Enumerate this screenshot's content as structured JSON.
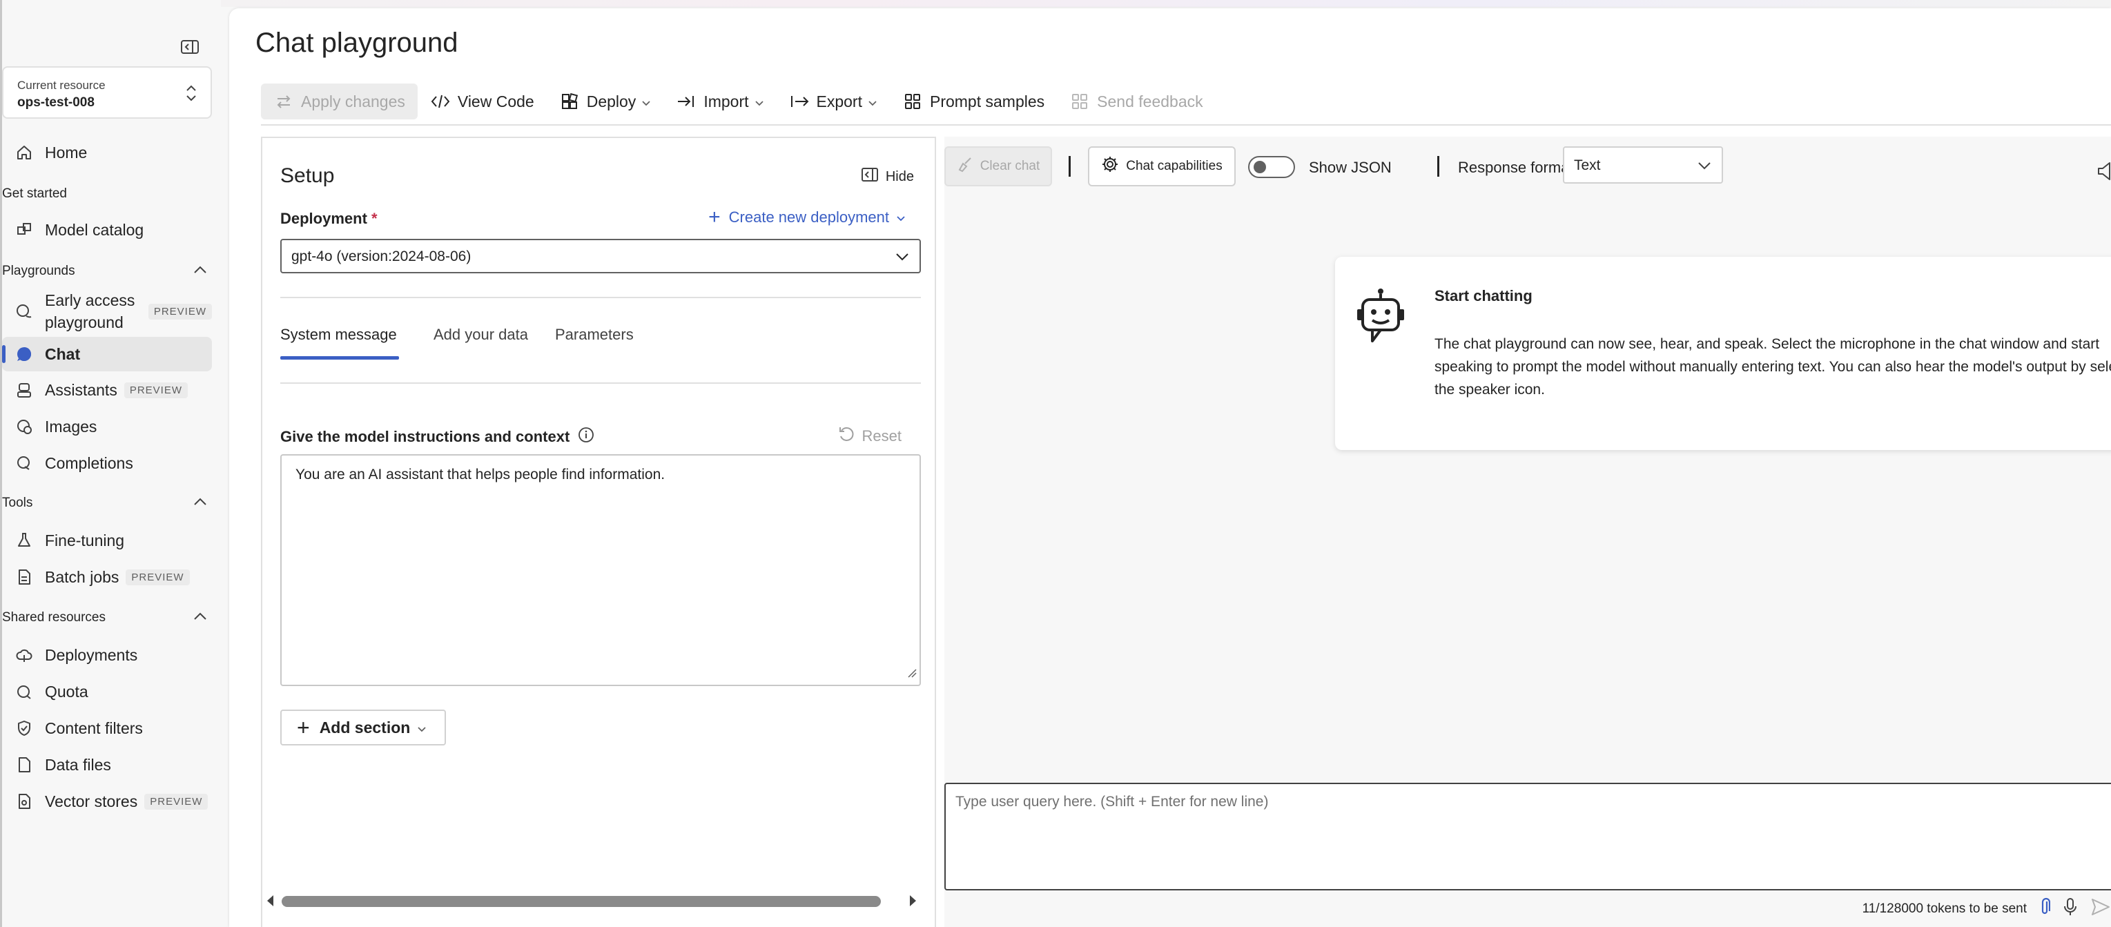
{
  "sidebar": {
    "resource_label": "Current resource",
    "resource_value": "ops-test-008",
    "home": "Home",
    "get_started": "Get started",
    "model_catalog": "Model catalog",
    "playgrounds": "Playgrounds",
    "early_access": "Early access playground",
    "preview": "PREVIEW",
    "chat": "Chat",
    "assistants": "Assistants",
    "images": "Images",
    "completions": "Completions",
    "tools": "Tools",
    "fine_tuning": "Fine-tuning",
    "batch_jobs": "Batch jobs",
    "shared_resources": "Shared resources",
    "deployments": "Deployments",
    "quota": "Quota",
    "content_filters": "Content filters",
    "data_files": "Data files",
    "vector_stores": "Vector stores"
  },
  "page": {
    "title": "Chat playground"
  },
  "toolbar": {
    "apply": "Apply changes",
    "view_code": "View Code",
    "deploy": "Deploy",
    "import": "Import",
    "export": "Export",
    "prompt_samples": "Prompt samples",
    "send_feedback": "Send feedback"
  },
  "setup": {
    "title": "Setup",
    "hide": "Hide",
    "deployment_label": "Deployment",
    "required_mark": "*",
    "create_deployment": "Create new deployment",
    "deployment_value": "gpt-4o (version:2024-08-06)",
    "tabs": [
      "System message",
      "Add your data",
      "Parameters"
    ],
    "instructions_label": "Give the model instructions and context",
    "reset": "Reset",
    "system_message": "You are an AI assistant that helps people find information.",
    "add_section": "Add section"
  },
  "chat": {
    "clear_chat": "Clear chat",
    "chat_capabilities": "Chat capabilities",
    "show_json": "Show JSON",
    "response_format_label": "Response format",
    "response_format_value": "Text",
    "card_title": "Start chatting",
    "card_body": "The chat playground can now see, hear, and speak. Select the microphone in the chat window and start speaking to prompt the model without manually entering text. You can also hear the model's output by selecting the speaker icon.",
    "query_placeholder": "Type user query here. (Shift + Enter for new line)",
    "tokens": "11/128000 tokens to be sent"
  },
  "colors": {
    "accent": "#3b5fc4",
    "required": "#c4314b"
  }
}
